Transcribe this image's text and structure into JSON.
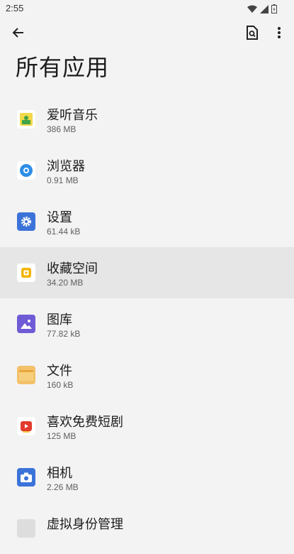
{
  "status_bar": {
    "time": "2:55"
  },
  "page": {
    "title": "所有应用"
  },
  "apps": [
    {
      "name": "爱听音乐",
      "size": "386 MB",
      "icon": "music-app-icon"
    },
    {
      "name": "浏览器",
      "size": "0.91 MB",
      "icon": "browser-icon"
    },
    {
      "name": "设置",
      "size": "61.44 kB",
      "icon": "settings-gear-icon"
    },
    {
      "name": "收藏空间",
      "size": "34.20 MB",
      "icon": "collection-space-icon"
    },
    {
      "name": "图库",
      "size": "77.82 kB",
      "icon": "gallery-icon"
    },
    {
      "name": "文件",
      "size": "160 kB",
      "icon": "folder-icon"
    },
    {
      "name": "喜欢免费短剧",
      "size": "125 MB",
      "icon": "short-drama-icon"
    },
    {
      "name": "相机",
      "size": "2.26 MB",
      "icon": "camera-icon"
    },
    {
      "name": "虚拟身份管理",
      "size": "",
      "icon": "virtual-identity-icon"
    }
  ]
}
